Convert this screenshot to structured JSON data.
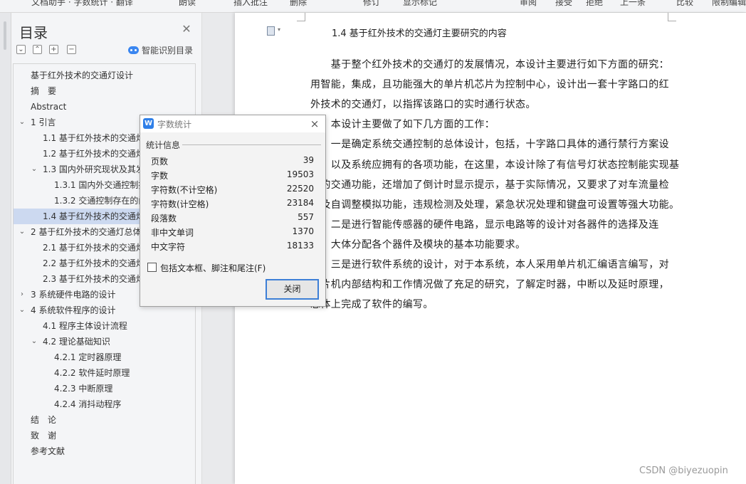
{
  "toolbar": {
    "items": [
      "文档助手 · 字数统计 · 翻译",
      "朗读",
      "插入批注",
      "删除",
      "修订",
      "显示标记",
      "审阅",
      "接受",
      "拒绝",
      "上一条",
      "比较",
      "限制编辑"
    ]
  },
  "toc": {
    "title": "目录",
    "smart_label": "智能识别目录",
    "tools": [
      "⌄",
      "⌃",
      "+",
      "−"
    ],
    "items": [
      {
        "label": "基于红外技术的交通灯设计",
        "level": 0,
        "arrow": ""
      },
      {
        "label": "摘　要",
        "level": 0,
        "arrow": ""
      },
      {
        "label": "Abstract",
        "level": 0,
        "arrow": ""
      },
      {
        "label": "1  引言",
        "level": 0,
        "arrow": "⌄"
      },
      {
        "label": "1.1 基于红外技术的交通灯",
        "level": 1,
        "arrow": ""
      },
      {
        "label": "1.2 基于红外技术的交通灯",
        "level": 1,
        "arrow": ""
      },
      {
        "label": "1.3 国内外研究现状及其发",
        "level": 1,
        "arrow": "⌄"
      },
      {
        "label": "1.3.1 国内外交通控制技",
        "level": 2,
        "arrow": ""
      },
      {
        "label": "1.3.2 交通控制存在的问",
        "level": 2,
        "arrow": ""
      },
      {
        "label": "1.4 基于红外技术的交通灯",
        "level": 1,
        "arrow": "",
        "selected": true
      },
      {
        "label": "2  基于红外技术的交通灯总体",
        "level": 0,
        "arrow": "⌄"
      },
      {
        "label": "2.1 基于红外技术的交通灯",
        "level": 1,
        "arrow": ""
      },
      {
        "label": "2.2 基于红外技术的交通灯",
        "level": 1,
        "arrow": ""
      },
      {
        "label": "2.3 基于红外技术的交通灯",
        "level": 1,
        "arrow": ""
      },
      {
        "label": "3  系统硬件电路的设计",
        "level": 0,
        "arrow": "›"
      },
      {
        "label": "4  系统软件程序的设计",
        "level": 0,
        "arrow": "⌄"
      },
      {
        "label": "4.1 程序主体设计流程",
        "level": 1,
        "arrow": ""
      },
      {
        "label": "4.2 理论基础知识",
        "level": 1,
        "arrow": "⌄"
      },
      {
        "label": "4.2.1 定时器原理",
        "level": 2,
        "arrow": ""
      },
      {
        "label": "4.2.2 软件延时原理",
        "level": 2,
        "arrow": ""
      },
      {
        "label": "4.2.3 中断原理",
        "level": 2,
        "arrow": ""
      },
      {
        "label": "4.2.4 消抖动程序",
        "level": 2,
        "arrow": ""
      },
      {
        "label": "结　论",
        "level": 0,
        "arrow": ""
      },
      {
        "label": "致　谢",
        "level": 0,
        "arrow": ""
      },
      {
        "label": "参考文献",
        "level": 0,
        "arrow": ""
      }
    ]
  },
  "document": {
    "heading": "1.4 基于红外技术的交通灯主要研究的内容",
    "lines": [
      "　　基于整个红外技术的交通灯的发展情况，本设计主要进行如下方面的研究：",
      "用智能，集成，且功能强大的单片机芯片为控制中心，设计出一套十字路口的红",
      "外技术的交通灯，以指挥该路口的实时通行状态。",
      "　　本设计主要做了如下几方面的工作：",
      "　　一是确定系统交通控制的总体设计，包括，十字路口具体的通行禁行方案设",
      "计，以及系统应拥有的各项功能，在这里，本设计除了有信号灯状态控制能实现基",
      "本的交通功能，还增加了倒计时显示提示，基于实际情况，又要求了对车流量检",
      "测及自调整模拟功能，违规检测及处理，紧急状况处理和键盘可设置等强大功能。",
      "　　二是进行智能传感器的硬件电路，显示电路等的设计对各器件的选择及连",
      "线，大体分配各个器件及模块的基本功能要求。",
      "　　三是进行软件系统的设计，对于本系统，本人采用单片机汇编语言编写，对",
      "单片机内部结构和工作情况做了充足的研究，了解定时器，中断以及延时原理，",
      "总体上完成了软件的编写。"
    ]
  },
  "dialog": {
    "title": "字数统计",
    "logo": "W",
    "close_icon": "×",
    "section": "统计信息",
    "stats": [
      {
        "label": "页数",
        "value": "39"
      },
      {
        "label": "字数",
        "value": "19503"
      },
      {
        "label": "字符数(不计空格)",
        "value": "22520"
      },
      {
        "label": "字符数(计空格)",
        "value": "23184"
      },
      {
        "label": "段落数",
        "value": "557"
      },
      {
        "label": "非中文单词",
        "value": "1370"
      },
      {
        "label": "中文字符",
        "value": "18133"
      }
    ],
    "checkbox_label": "包括文本框、脚注和尾注(F)",
    "checkbox_checked": false,
    "button_label": "关闭"
  },
  "watermark": "CSDN @biyezuopin"
}
